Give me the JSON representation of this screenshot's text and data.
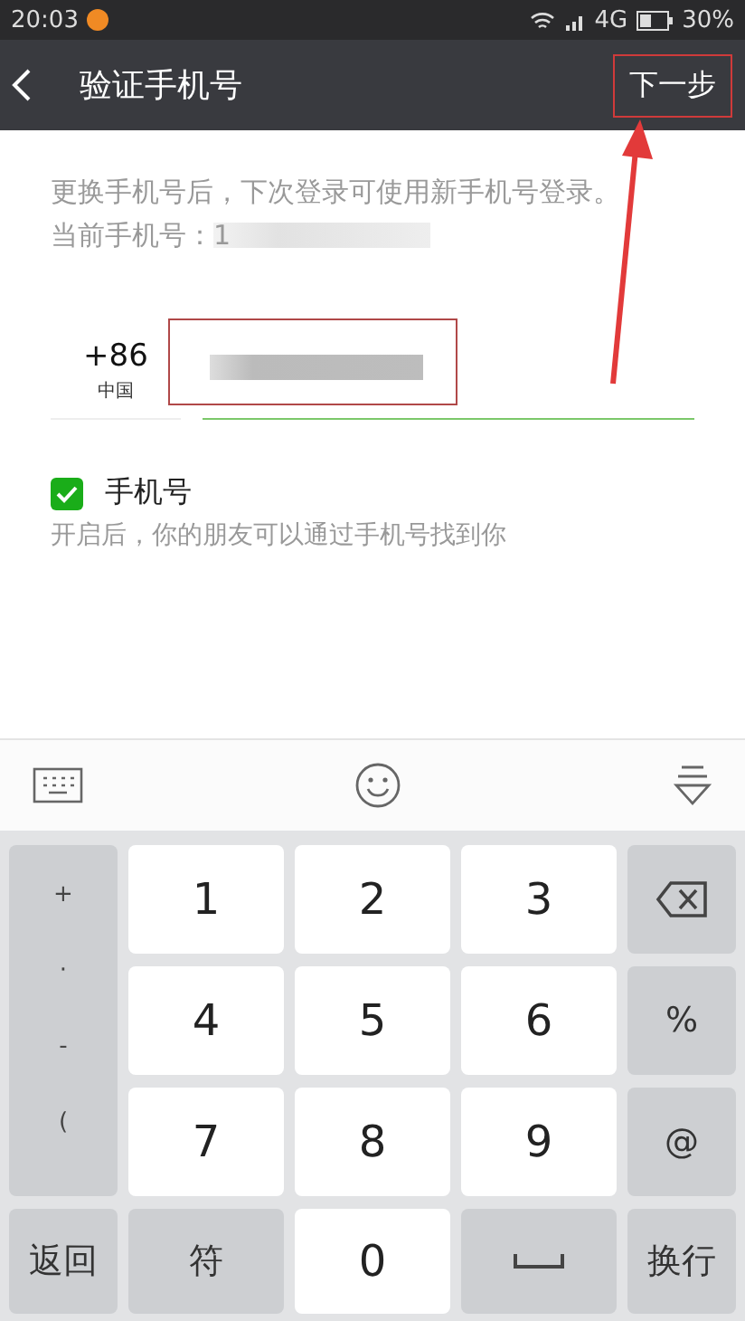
{
  "status_bar": {
    "time": "20:03",
    "network": "4G",
    "battery": "30%"
  },
  "header": {
    "title": "验证手机号",
    "action": "下一步"
  },
  "notice": "更换手机号后，下次登录可使用新手机号登录。当前手机号：1",
  "phone": {
    "country_code": "+86",
    "country": "中国"
  },
  "discoverable": {
    "label": "手机号",
    "checked": true,
    "hint": "开启后，你的朋友可以通过手机号找到你"
  },
  "keyboard": {
    "side_keys": [
      "+",
      "·",
      "-",
      "("
    ],
    "keys": [
      {
        "kind": "digit",
        "label": "1"
      },
      {
        "kind": "digit",
        "label": "2"
      },
      {
        "kind": "digit",
        "label": "3"
      },
      {
        "kind": "backspace"
      },
      {
        "kind": "digit",
        "label": "4"
      },
      {
        "kind": "digit",
        "label": "5"
      },
      {
        "kind": "digit",
        "label": "6"
      },
      {
        "kind": "function",
        "label": "%"
      },
      {
        "kind": "digit",
        "label": "7"
      },
      {
        "kind": "digit",
        "label": "8"
      },
      {
        "kind": "digit",
        "label": "9"
      },
      {
        "kind": "function",
        "label": "@"
      },
      {
        "kind": "function",
        "label": "返回"
      },
      {
        "kind": "function",
        "label": "符"
      },
      {
        "kind": "digit",
        "label": "0"
      },
      {
        "kind": "space"
      },
      {
        "kind": "function",
        "label": "换行"
      }
    ]
  }
}
